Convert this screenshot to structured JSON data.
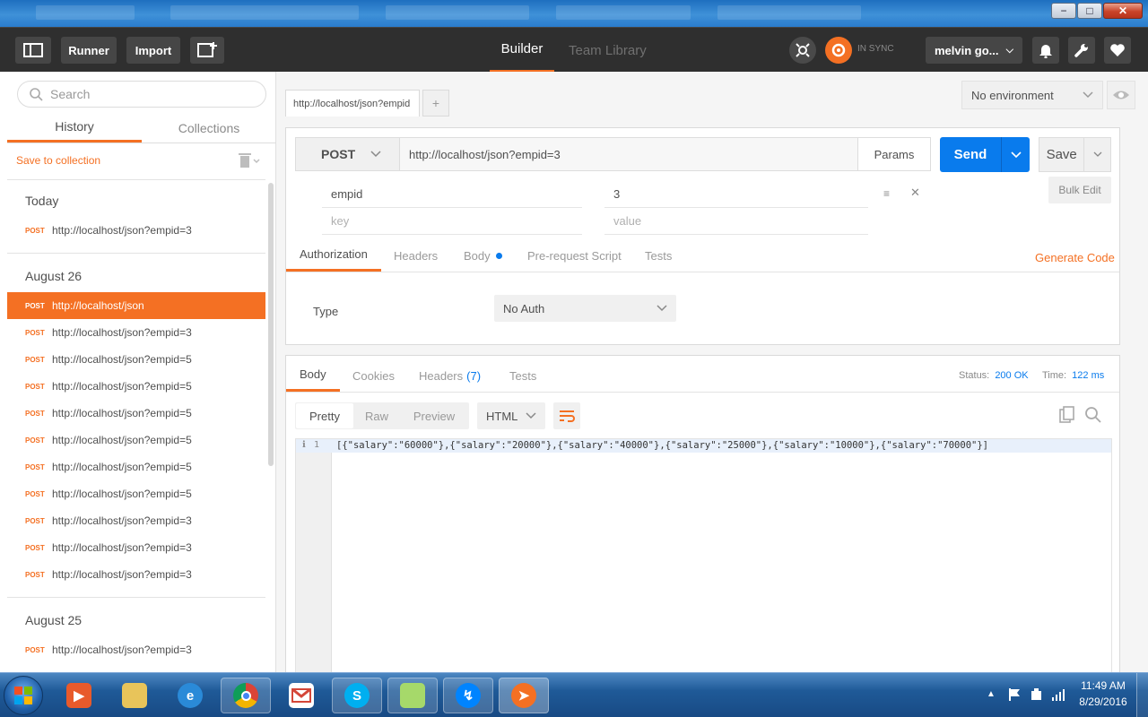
{
  "window": {
    "minimize": "−",
    "maximize": "□",
    "close": "✕"
  },
  "header": {
    "runner": "Runner",
    "import": "Import",
    "builder": "Builder",
    "team_library": "Team Library",
    "sync": "IN SYNC",
    "user": "melvin go..."
  },
  "sidebar": {
    "search_placeholder": "Search",
    "tab_history": "History",
    "tab_collections": "Collections",
    "save_to_collection": "Save to collection",
    "sections": [
      {
        "title": "Today",
        "items": [
          {
            "method": "POST",
            "url": "http://localhost/json?empid=3"
          }
        ]
      },
      {
        "title": "August 26",
        "items": [
          {
            "method": "POST",
            "url": "http://localhost/json",
            "selected": true
          },
          {
            "method": "POST",
            "url": "http://localhost/json?empid=3"
          },
          {
            "method": "POST",
            "url": "http://localhost/json?empid=5"
          },
          {
            "method": "POST",
            "url": "http://localhost/json?empid=5"
          },
          {
            "method": "POST",
            "url": "http://localhost/json?empid=5"
          },
          {
            "method": "POST",
            "url": "http://localhost/json?empid=5"
          },
          {
            "method": "POST",
            "url": "http://localhost/json?empid=5"
          },
          {
            "method": "POST",
            "url": "http://localhost/json?empid=5"
          },
          {
            "method": "POST",
            "url": "http://localhost/json?empid=3"
          },
          {
            "method": "POST",
            "url": "http://localhost/json?empid=3"
          },
          {
            "method": "POST",
            "url": "http://localhost/json?empid=3"
          }
        ]
      },
      {
        "title": "August 25",
        "items": [
          {
            "method": "POST",
            "url": "http://localhost/json?empid=3"
          }
        ]
      }
    ]
  },
  "request": {
    "tab_label": "http://localhost/json?empid",
    "new_tab": "+",
    "environment": "No environment",
    "method": "POST",
    "url": "http://localhost/json?empid=3",
    "params": "Params",
    "send": "Send",
    "save": "Save",
    "param_key": "empid",
    "param_value": "3",
    "key_placeholder": "key",
    "value_placeholder": "value",
    "bulk_edit": "Bulk Edit",
    "tabs": [
      "Authorization",
      "Headers",
      "Body",
      "Pre-request Script",
      "Tests"
    ],
    "generate_code": "Generate Code",
    "auth_type_label": "Type",
    "auth_type": "No Auth"
  },
  "response": {
    "tabs": [
      "Body",
      "Cookies",
      "Headers",
      "Tests"
    ],
    "headers_count": "(7)",
    "status_label": "Status:",
    "status": "200 OK",
    "time_label": "Time:",
    "time": "122 ms",
    "views": [
      "Pretty",
      "Raw",
      "Preview"
    ],
    "format": "HTML",
    "line_number": "1",
    "body": "[{\"salary\":\"60000\"},{\"salary\":\"20000\"},{\"salary\":\"40000\"},{\"salary\":\"25000\"},{\"salary\":\"10000\"},{\"salary\":\"70000\"}]"
  },
  "taskbar": {
    "time": "11:49 AM",
    "date": "8/29/2016"
  },
  "colors": {
    "accent": "#f47023",
    "send": "#097bed",
    "header_bg": "#2f2f2f"
  }
}
